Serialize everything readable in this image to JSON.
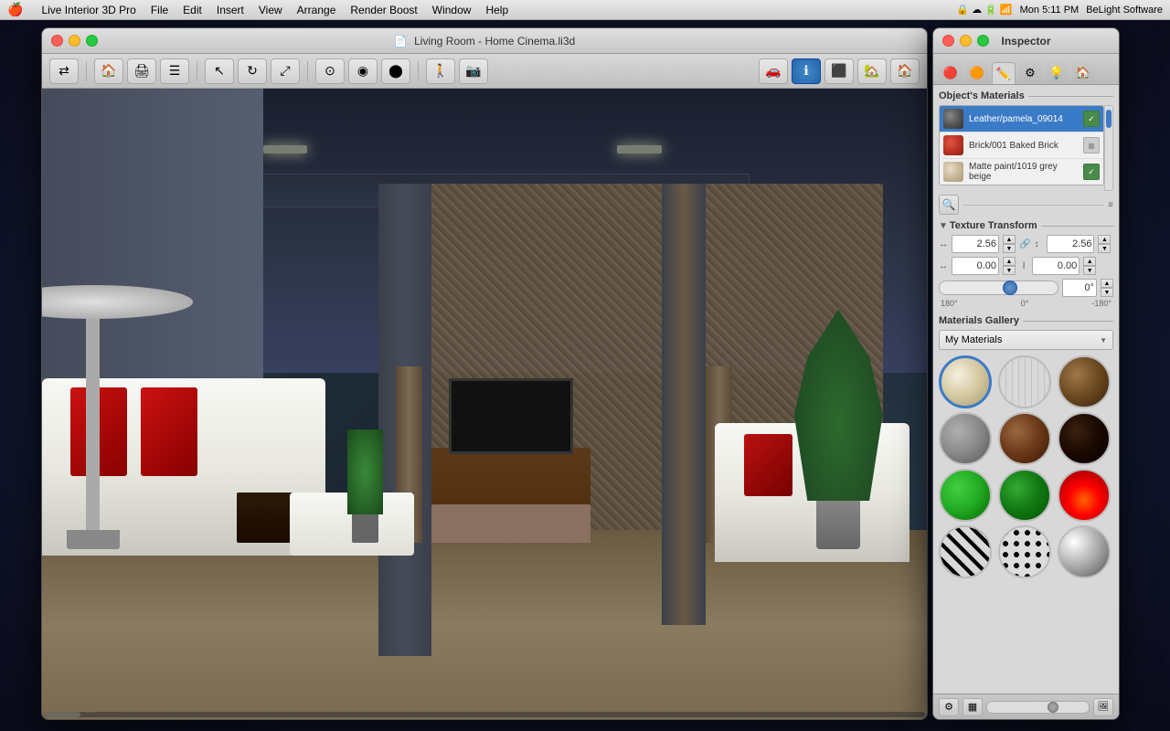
{
  "menubar": {
    "apple": "🍎",
    "app_name": "Live Interior 3D Pro",
    "menus": [
      "File",
      "Edit",
      "Insert",
      "View",
      "Arrange",
      "Render Boost",
      "Window",
      "Help"
    ],
    "right": {
      "time": "Mon 5:11 PM",
      "brand": "BeLight Software"
    }
  },
  "main_window": {
    "title": "Living Room - Home Cinema.li3d",
    "close_label": "×",
    "minimize_label": "−",
    "maximize_label": "+"
  },
  "toolbar": {
    "buttons": [
      "←→",
      "🏠",
      "🖨",
      "☰",
      "↕",
      "⊙",
      "◉",
      "🔵",
      "✂",
      "📷",
      "🔧",
      "📷2",
      "🔵2",
      "ℹ",
      "⬛",
      "🏠2",
      "🏠3"
    ]
  },
  "inspector": {
    "title": "Inspector",
    "tabs": [
      "🔴",
      "🟡",
      "✏️",
      "⚙️",
      "💡",
      "🏠"
    ],
    "objects_materials_label": "Object's Materials",
    "materials": [
      {
        "name": "Leather/pamela_09014",
        "color": "#5a5a5a",
        "selected": true
      },
      {
        "name": "Brick/001 Baked Brick",
        "color": "#bb3322",
        "selected": false
      },
      {
        "name": "Matte paint/1019 grey beige",
        "color": "#c8b898",
        "selected": false
      }
    ],
    "texture_transform": {
      "label": "Texture Transform",
      "width_val": "2.56",
      "height_val": "2.56",
      "offset_x": "0.00",
      "offset_y": "0.00",
      "angle_val": "0°",
      "angle_label_left": "180°",
      "angle_label_center": "0°",
      "angle_label_right": "-180°"
    },
    "materials_gallery": {
      "label": "Materials Gallery",
      "dropdown_selected": "My Materials",
      "items": [
        {
          "id": "cream",
          "class": "mat-cream"
        },
        {
          "id": "wood-light",
          "class": "mat-wood-light"
        },
        {
          "id": "wood-dark",
          "class": "mat-wood-dark"
        },
        {
          "id": "concrete",
          "class": "mat-concrete"
        },
        {
          "id": "brown",
          "class": "mat-brown"
        },
        {
          "id": "dark-brown",
          "class": "mat-dark-brown"
        },
        {
          "id": "green-bright",
          "class": "mat-green-bright"
        },
        {
          "id": "green-dark",
          "class": "mat-green-dark"
        },
        {
          "id": "fire",
          "class": "mat-fire"
        },
        {
          "id": "zebra",
          "class": "mat-zebra"
        },
        {
          "id": "dots",
          "class": "mat-dots"
        },
        {
          "id": "chrome",
          "class": "mat-chrome"
        }
      ]
    }
  }
}
